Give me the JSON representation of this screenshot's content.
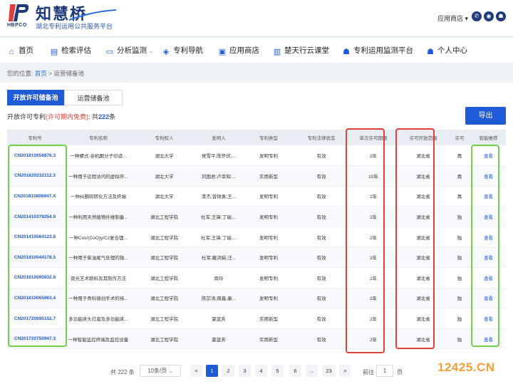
{
  "header": {
    "brand_name": "知慧桥",
    "brand_code": "HBPCO",
    "tagline": "湖北专利运用公共服务平台",
    "app_store": "应用商店",
    "icons": [
      "wechat-icon",
      "weibo-icon",
      "user-icon"
    ]
  },
  "nav": [
    {
      "label": "首页",
      "icon": "home-icon",
      "glyph": "⌂"
    },
    {
      "label": "检索评估",
      "icon": "document-icon",
      "glyph": "▤"
    },
    {
      "label": "分析监测",
      "icon": "monitor-icon",
      "glyph": "▭"
    },
    {
      "label": "专利导航",
      "icon": "layers-icon",
      "glyph": "◈"
    },
    {
      "label": "应用商店",
      "icon": "shop-icon",
      "glyph": "▣"
    },
    {
      "label": "楚天行云课堂",
      "icon": "books-icon",
      "glyph": "▥"
    },
    {
      "label": "专利运用监测平台",
      "icon": "person-icon",
      "glyph": "☗"
    },
    {
      "label": "个人中心",
      "icon": "person-icon",
      "glyph": "☗"
    }
  ],
  "breadcrumb": {
    "prefix": "您的位置:",
    "home": "首页",
    "sep": ">",
    "current": "运营储备池"
  },
  "tabs": {
    "active": "开放许可储备池",
    "inactive": "运营储备池"
  },
  "summary": {
    "label": "开放许可专利",
    "note": "(许可期内免费)",
    "sep": ":",
    "total_prefix": "共",
    "count": "222",
    "unit": "条"
  },
  "export_label": "导出",
  "table": {
    "headers": [
      "专利号",
      "专利名称",
      "专利权人",
      "发明人",
      "专利类型",
      "专利法律状态",
      "单次许可期限",
      "许可开放范围",
      "许可",
      "智能推荐"
    ],
    "rows": [
      [
        "CN201810658876.3",
        "一种螺式-亲机酮分子印迹...",
        "湖北大学",
        "党雪平;陈怀伏;...",
        "发明专利",
        "有效",
        "2年",
        "湖北省",
        "再",
        "查看"
      ],
      [
        "CN201820232112.3",
        "一种用于远程访问的虚拟环...",
        "湖北大学",
        "刘国君;卢幸知;...",
        "实用新型",
        "有效",
        "10年",
        "湖北省",
        "再",
        "查看"
      ],
      [
        "CN201810806947.X",
        "一种纠删码转化方法及终端",
        "湖北大学",
        "李杰;曾祥勇;王...",
        "发明专利",
        "有效",
        "2年",
        "湖北省",
        "再",
        "查看"
      ],
      [
        "CN201410379254.9",
        "一种利用天然植物纤维制备...",
        "湖北工程学院",
        "杜军;王锋;丁瑜;...",
        "发明专利",
        "有效",
        "2年",
        "湖北省",
        "独",
        "查看"
      ],
      [
        "CN201410564123.8",
        "一种Cox/(CoO)y/Cz复合锂...",
        "湖北工程学院",
        "杜军;王锋;丁瑜;...",
        "发明专利",
        "有效",
        "2年",
        "湖北省",
        "独",
        "查看"
      ],
      [
        "CN201810044178.5",
        "一种用于柴油尾气处理的微...",
        "湖北工程学院",
        "杜军;戴洪娟;汪...",
        "发明专利",
        "有效",
        "2年",
        "湖北省",
        "独",
        "查看"
      ],
      [
        "CN201610095932.8",
        "夜光艺术颜料及其制作方法",
        "湖北工程学院",
        "周玲",
        "发明专利",
        "有效",
        "2年",
        "湖北省",
        "独",
        "查看"
      ],
      [
        "CN201810065063.4",
        "一种用于骨科微创手术的持...",
        "湖北工程学院",
        "陈宗涛;周鑫;康...",
        "发明专利",
        "有效",
        "2年",
        "湖北省",
        "独",
        "查看"
      ],
      [
        "CN201720695152.7",
        "多功能床头灯座及多功能床...",
        "湖北工程学院",
        "夏蓝芳",
        "实用新型",
        "有效",
        "2年",
        "湖北省",
        "独",
        "查看"
      ],
      [
        "CN201720750947.3",
        "一种智能监控终端及监控设备",
        "湖北工程学院",
        "夏蓝芳",
        "实用新型",
        "有效",
        "2年",
        "湖北省",
        "独",
        "查看"
      ]
    ]
  },
  "pagination": {
    "total_text": "共 222 条",
    "page_size": "10条/页",
    "prev": "<",
    "pages": [
      "1",
      "2",
      "3",
      "4",
      "5",
      "6",
      "...",
      "23"
    ],
    "active_page": "1",
    "next": ">",
    "goto_label": "前往",
    "goto_value": "1",
    "goto_unit": "页"
  },
  "watermark": "12425.CN",
  "colors": {
    "primary": "#1f5bd6",
    "brand": "#1f3a7a",
    "highlight_red": "#e0403a",
    "highlight_green": "#6fd24a",
    "watermark": "#f4a03a"
  }
}
